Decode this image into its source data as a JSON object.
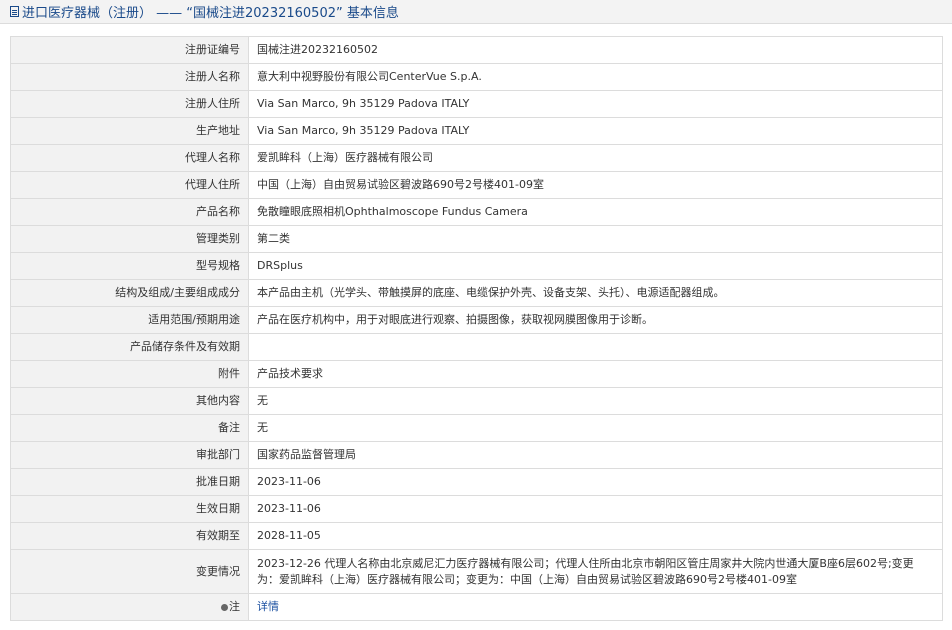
{
  "header": {
    "title": "进口医疗器械（注册） —— “国械注进20232160502” 基本信息"
  },
  "rows": [
    {
      "label": "注册证编号",
      "value": "国械注进20232160502"
    },
    {
      "label": "注册人名称",
      "value": "意大利中视野股份有限公司CenterVue S.p.A."
    },
    {
      "label": "注册人住所",
      "value": "Via San Marco, 9h 35129 Padova ITALY"
    },
    {
      "label": "生产地址",
      "value": "Via San Marco, 9h 35129 Padova ITALY"
    },
    {
      "label": "代理人名称",
      "value": "爱凯眸科（上海）医疗器械有限公司"
    },
    {
      "label": "代理人住所",
      "value": "中国（上海）自由贸易试验区碧波路690号2号楼401-09室"
    },
    {
      "label": "产品名称",
      "value": "免散瞳眼底照相机Ophthalmoscope Fundus Camera"
    },
    {
      "label": "管理类别",
      "value": "第二类"
    },
    {
      "label": "型号规格",
      "value": "DRSplus"
    },
    {
      "label": "结构及组成/主要组成成分",
      "value": "本产品由主机（光学头、带触摸屏的底座、电缆保护外壳、设备支架、头托）、电源适配器组成。"
    },
    {
      "label": "适用范围/预期用途",
      "value": "产品在医疗机构中，用于对眼底进行观察、拍摄图像，获取视网膜图像用于诊断。"
    },
    {
      "label": "产品储存条件及有效期",
      "value": ""
    },
    {
      "label": "附件",
      "value": "产品技术要求"
    },
    {
      "label": "其他内容",
      "value": "无"
    },
    {
      "label": "备注",
      "value": "无"
    },
    {
      "label": "审批部门",
      "value": "国家药品监督管理局"
    },
    {
      "label": "批准日期",
      "value": "2023-11-06"
    },
    {
      "label": "生效日期",
      "value": "2023-11-06"
    },
    {
      "label": "有效期至",
      "value": "2028-11-05"
    },
    {
      "label": "变更情况",
      "value": "2023-12-26 代理人名称由北京威尼汇力医疗器械有限公司；代理人住所由北京市朝阳区管庄周家井大院内世通大厦B座6层602号;变更为：爱凯眸科（上海）医疗器械有限公司；变更为：中国（上海）自由贸易试验区碧波路690号2号楼401-09室"
    }
  ],
  "note_row": {
    "label": "注",
    "link_text": "详情"
  }
}
